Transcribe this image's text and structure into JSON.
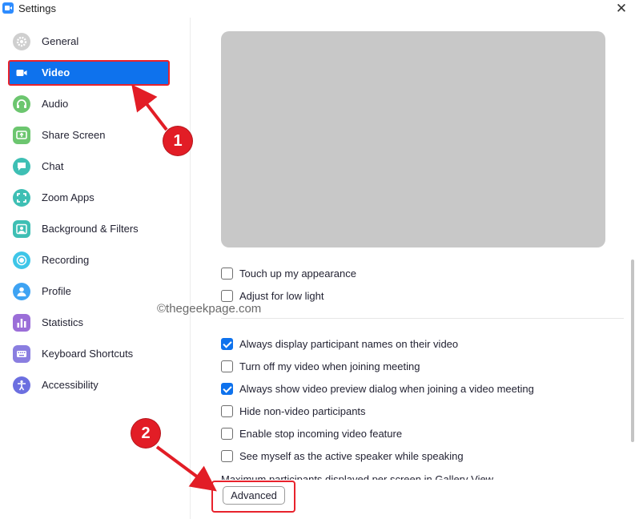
{
  "window": {
    "title": "Settings",
    "close_glyph": "✕"
  },
  "sidebar": {
    "items": [
      {
        "label": "General",
        "icon": "gear-icon",
        "color": "#cfcfcf"
      },
      {
        "label": "Video",
        "icon": "video-camera-icon",
        "color": "#ffffff",
        "active": true
      },
      {
        "label": "Audio",
        "icon": "headphones-icon",
        "color": "#6cc66f"
      },
      {
        "label": "Share Screen",
        "icon": "share-screen-icon",
        "color": "#6cc66f"
      },
      {
        "label": "Chat",
        "icon": "chat-bubble-icon",
        "color": "#3ebfb4"
      },
      {
        "label": "Zoom Apps",
        "icon": "apps-icon",
        "color": "#3ebfb4"
      },
      {
        "label": "Background & Filters",
        "icon": "background-icon",
        "color": "#3ebfb4"
      },
      {
        "label": "Recording",
        "icon": "record-icon",
        "color": "#3ec6e8"
      },
      {
        "label": "Profile",
        "icon": "person-icon",
        "color": "#3ea3f3"
      },
      {
        "label": "Statistics",
        "icon": "bar-chart-icon",
        "color": "#9b6ed8"
      },
      {
        "label": "Keyboard Shortcuts",
        "icon": "keyboard-icon",
        "color": "#8a7ee0"
      },
      {
        "label": "Accessibility",
        "icon": "accessibility-icon",
        "color": "#6c6fe0"
      }
    ]
  },
  "video": {
    "options_top": [
      {
        "label": "Touch up my appearance",
        "checked": false
      },
      {
        "label": "Adjust for low light",
        "checked": false
      }
    ],
    "options_bottom": [
      {
        "label": "Always display participant names on their video",
        "checked": true
      },
      {
        "label": "Turn off my video when joining meeting",
        "checked": false
      },
      {
        "label": "Always show video preview dialog when joining a video meeting",
        "checked": true
      },
      {
        "label": "Hide non-video participants",
        "checked": false
      },
      {
        "label": "Enable stop incoming video feature",
        "checked": false
      },
      {
        "label": "See myself as the active speaker while speaking",
        "checked": false
      }
    ],
    "clipped_label": "Maximum participants displayed per screen in Gallery View",
    "advanced_label": "Advanced"
  },
  "watermark": "©thegeekpage.com",
  "annotations": {
    "marker_1": "1",
    "marker_2": "2",
    "color": "#e21d26"
  },
  "colors": {
    "accent": "#0e72ed",
    "highlight": "#e8222c",
    "preview": "#c8c8c8"
  }
}
